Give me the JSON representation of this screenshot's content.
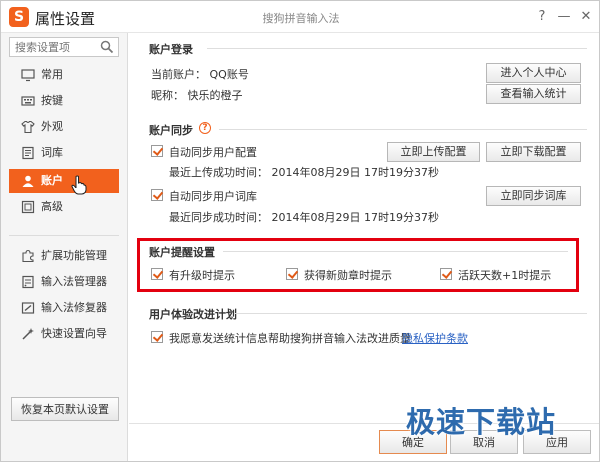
{
  "window": {
    "title": "属性设置",
    "center_title": "搜狗拼音输入法",
    "logo_letter": "S",
    "help_glyph": "?",
    "min_glyph": "—",
    "close_glyph": "✕"
  },
  "sidebar": {
    "search_placeholder": "搜索设置项",
    "items": [
      {
        "label": "常用",
        "icon": "monitor-icon"
      },
      {
        "label": "按键",
        "icon": "keyboard-icon"
      },
      {
        "label": "外观",
        "icon": "shirt-icon"
      },
      {
        "label": "词库",
        "icon": "book-icon"
      },
      {
        "label": "账户",
        "icon": "user-icon",
        "active": true
      },
      {
        "label": "高级",
        "icon": "advanced-icon"
      }
    ],
    "tools": [
      {
        "label": "扩展功能管理",
        "icon": "puzzle-icon"
      },
      {
        "label": "输入法管理器",
        "icon": "manager-icon"
      },
      {
        "label": "输入法修复器",
        "icon": "repair-icon"
      },
      {
        "label": "快速设置向导",
        "icon": "wizard-icon"
      }
    ],
    "restore_label": "恢复本页默认设置"
  },
  "account_login": {
    "title": "账户登录",
    "current_account": "当前账户： QQ账号",
    "nickname": "昵称：  快乐的橙子",
    "enter_center_label": "进入个人中心",
    "view_stats_label": "查看输入统计"
  },
  "account_sync": {
    "title": "账户同步",
    "auto_sync_config_label": "自动同步用户配置",
    "last_upload": "最近上传成功时间：  2014年08月29日  17时19分37秒",
    "upload_config_label": "立即上传配置",
    "download_config_label": "立即下载配置",
    "auto_sync_dict_label": "自动同步用户词库",
    "last_sync": "最近同步成功时间：  2014年08月29日  17时19分37秒",
    "sync_dict_label": "立即同步词库"
  },
  "account_reminder": {
    "title": "账户提醒设置",
    "options": [
      "有升级时提示",
      "获得新勋章时提示",
      "活跃天数+1时提示"
    ]
  },
  "ux_program": {
    "title": "用户体验改进计划",
    "agree_label": "我愿意发送统计信息帮助搜狗拼音输入法改进质量",
    "privacy_link": "隐私保护条款"
  },
  "footer": {
    "ok_label": "确定",
    "cancel_label": "取消",
    "apply_label": "应用"
  },
  "watermark": "极速下载站",
  "colors": {
    "accent": "#f2611d",
    "highlight_box": "#e3000f",
    "link": "#2a62c4"
  }
}
